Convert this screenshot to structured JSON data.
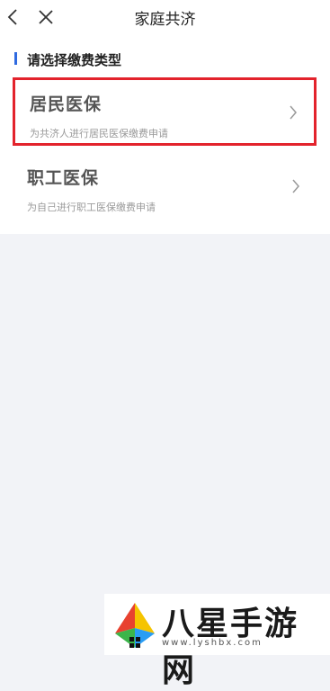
{
  "header": {
    "title": "家庭共济",
    "back_icon": "chevron-left-icon",
    "close_icon": "close-icon"
  },
  "section": {
    "heading": "请选择缴费类型",
    "accent_color": "#2f6ae0"
  },
  "options": [
    {
      "title": "居民医保",
      "description": "为共济人进行居民医保缴费申请",
      "selected": true
    },
    {
      "title": "职工医保",
      "description": "为自己进行职工医保缴费申请",
      "selected": false
    }
  ],
  "highlight_color": "#e3232c",
  "watermark": {
    "brand": "八星手游网",
    "url": "www.lyshbx.com"
  }
}
